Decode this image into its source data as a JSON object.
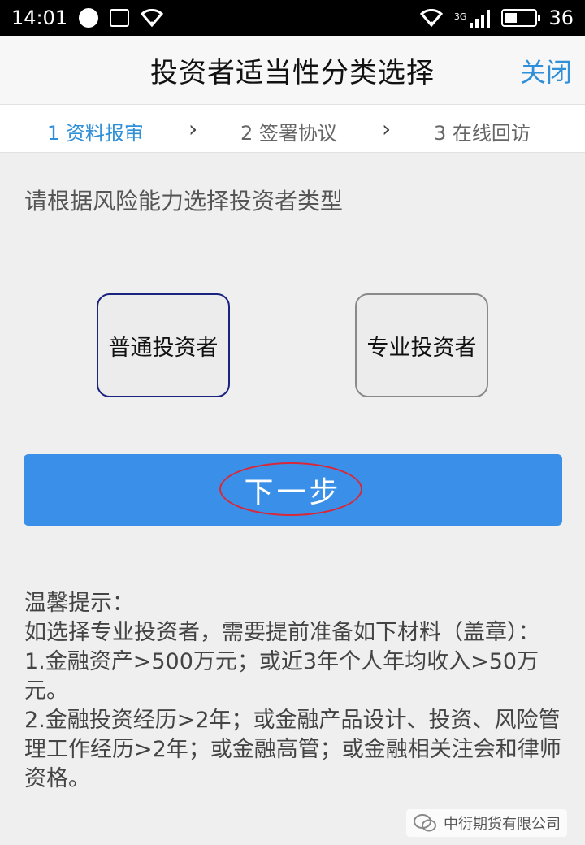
{
  "status_bar": {
    "time": "14:01",
    "network_type": "3G",
    "battery_level": "36"
  },
  "header": {
    "title": "投资者适当性分类选择",
    "close_label": "关闭"
  },
  "steps": [
    {
      "label": "1 资料报审",
      "active": true
    },
    {
      "label": "2 签署协议",
      "active": false
    },
    {
      "label": "3 在线回访",
      "active": false
    }
  ],
  "step_separator": "›",
  "main": {
    "prompt": "请根据风险能力选择投资者类型",
    "options": [
      {
        "label": "普通投资者",
        "selected": true
      },
      {
        "label": "专业投资者",
        "selected": false
      }
    ],
    "next_label": "下一步"
  },
  "tips": {
    "title": "温馨提示：",
    "lines": [
      "如选择专业投资者，需要提前准备如下材料（盖章）：",
      "1.金融资产>500万元；或近3年个人年均收入>50万元。",
      "2.金融投资经历>2年；或金融产品设计、投资、风险管理工作经历>2年；或金融高管；或金融相关注会和律师资格。"
    ]
  },
  "watermark": {
    "text": "中衍期货有限公司"
  },
  "colors": {
    "accent": "#2f8fd8",
    "button": "#3a90e8",
    "selected_border": "#1a237e",
    "highlight_ellipse": "#d8283a"
  }
}
